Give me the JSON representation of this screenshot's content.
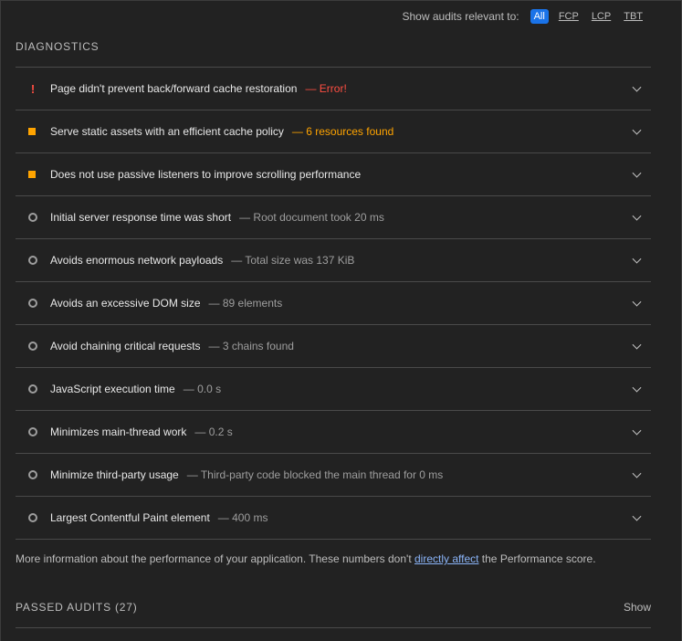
{
  "filter": {
    "label": "Show audits relevant to:",
    "options": [
      "All",
      "FCP",
      "LCP",
      "TBT"
    ],
    "active": "All"
  },
  "diagnostics": {
    "title": "DIAGNOSTICS",
    "audits": [
      {
        "status": "error",
        "title": "Page didn't prevent back/forward cache restoration",
        "detail": "— Error!"
      },
      {
        "status": "warn",
        "title": "Serve static assets with an efficient cache policy",
        "detail": "— 6 resources found"
      },
      {
        "status": "warn",
        "title": "Does not use passive listeners to improve scrolling performance",
        "detail": ""
      },
      {
        "status": "pass",
        "title": "Initial server response time was short",
        "detail": "— Root document took 20 ms"
      },
      {
        "status": "pass",
        "title": "Avoids enormous network payloads",
        "detail": "— Total size was 137 KiB"
      },
      {
        "status": "pass",
        "title": "Avoids an excessive DOM size",
        "detail": "— 89 elements"
      },
      {
        "status": "pass",
        "title": "Avoid chaining critical requests",
        "detail": "— 3 chains found"
      },
      {
        "status": "pass",
        "title": "JavaScript execution time",
        "detail": "— 0.0 s"
      },
      {
        "status": "pass",
        "title": "Minimizes main-thread work",
        "detail": "— 0.2 s"
      },
      {
        "status": "pass",
        "title": "Minimize third-party usage",
        "detail": "— Third-party code blocked the main thread for 0 ms"
      },
      {
        "status": "pass",
        "title": "Largest Contentful Paint element",
        "detail": "— 400 ms"
      }
    ]
  },
  "info": {
    "before": "More information about the performance of your application. These numbers don't ",
    "link": "directly affect",
    "after": " the Performance score."
  },
  "passed": {
    "title": "PASSED AUDITS (27)",
    "show_label": "Show"
  },
  "colors": {
    "error": "#ff4e42",
    "warn": "#ffa400",
    "pass": "#9e9e9e",
    "accent": "#1a73e8",
    "link": "#8ab4f8"
  }
}
